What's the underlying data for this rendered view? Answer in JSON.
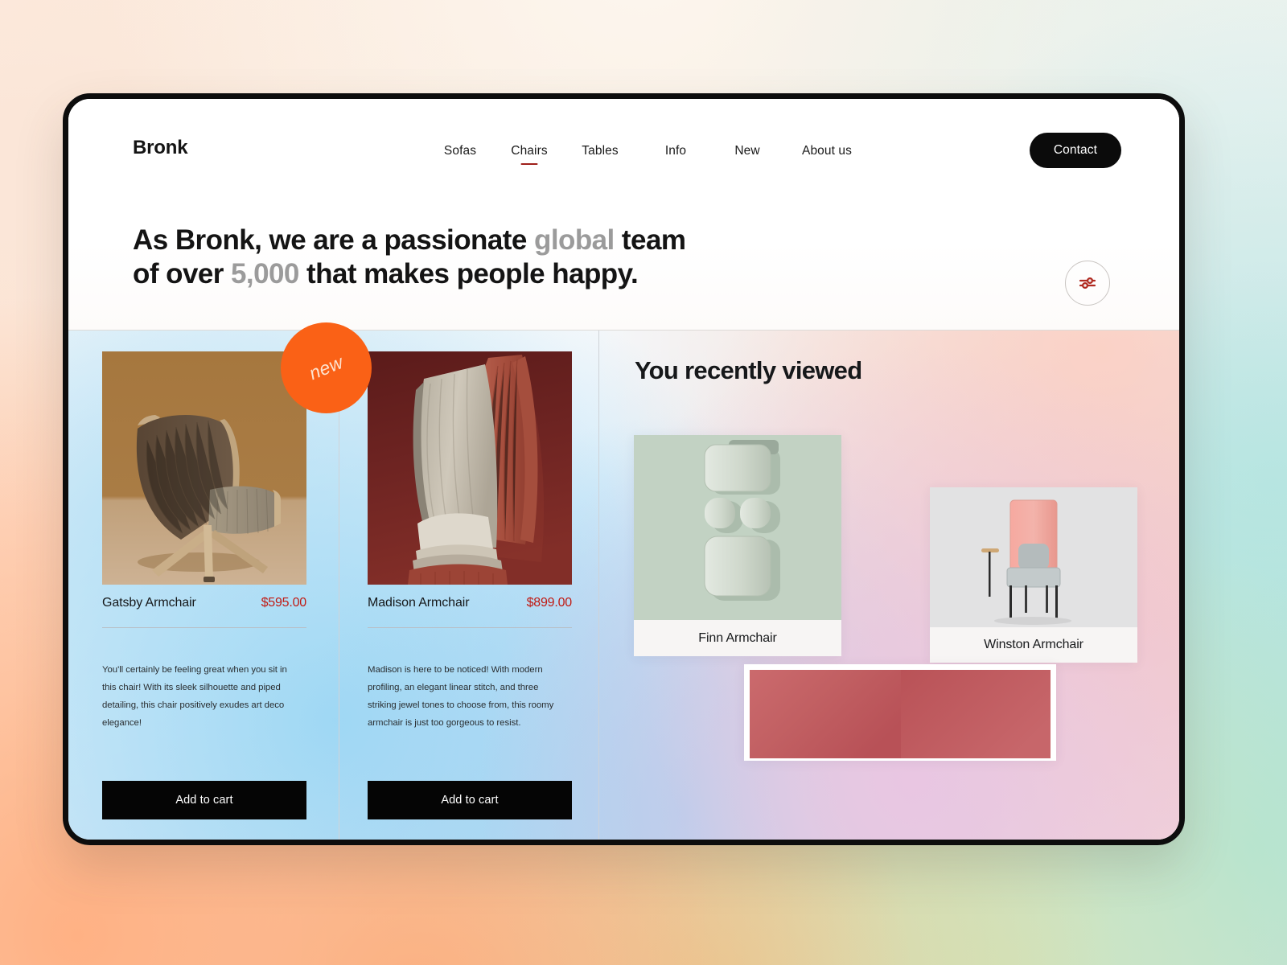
{
  "brand": {
    "name": "Bronk"
  },
  "nav": {
    "items": [
      {
        "label": "Sofas",
        "active": false
      },
      {
        "label": "Chairs",
        "active": true
      },
      {
        "label": "Tables",
        "active": false
      },
      {
        "label": "Info",
        "active": false
      },
      {
        "label": "New",
        "active": false
      },
      {
        "label": "About us",
        "active": false
      }
    ],
    "contact_label": "Contact",
    "active_underline_color": "#9e1f1a"
  },
  "hero": {
    "line1_a": "As Bronk, we are a passionate ",
    "line1_muted": "global",
    "line1_b": " team",
    "line2_a": "of over ",
    "line2_muted": "5,000",
    "line2_b": " that makes people happy.",
    "filter_icon": "sliders-icon"
  },
  "badge": {
    "label": "new",
    "color": "#fa6116"
  },
  "products": [
    {
      "name": "Gatsby Armchair",
      "price": "$595.00",
      "description": "You'll certainly be feeling great when you sit in this chair!  With its sleek silhouette and piped detailing, this chair positively exudes art deco elegance!",
      "cta": "Add to cart",
      "image_name": "gatsby-armchair-photo",
      "has_new_badge": true
    },
    {
      "name": "Madison Armchair",
      "price": "$899.00",
      "description": "Madison is here to be noticed! With modern profiling, an elegant linear stitch, and three striking jewel tones to choose from, this roomy armchair is just too gorgeous to resist.",
      "cta": "Add to cart",
      "image_name": "madison-armchair-photo",
      "has_new_badge": false
    }
  ],
  "recently_viewed": {
    "title": "You recently viewed",
    "items": [
      {
        "name": "Finn Armchair",
        "image_name": "finn-armchair-photo"
      },
      {
        "name": "Winston Armchair",
        "image_name": "winston-armchair-photo"
      },
      {
        "name": "",
        "image_name": "red-chair-photo-partial"
      }
    ]
  },
  "colors": {
    "price": "#c01a13",
    "accent_orange": "#fa6116",
    "text_dark": "#141414",
    "text_muted": "#9b9b9b",
    "button_dark": "#0b0b0b"
  }
}
